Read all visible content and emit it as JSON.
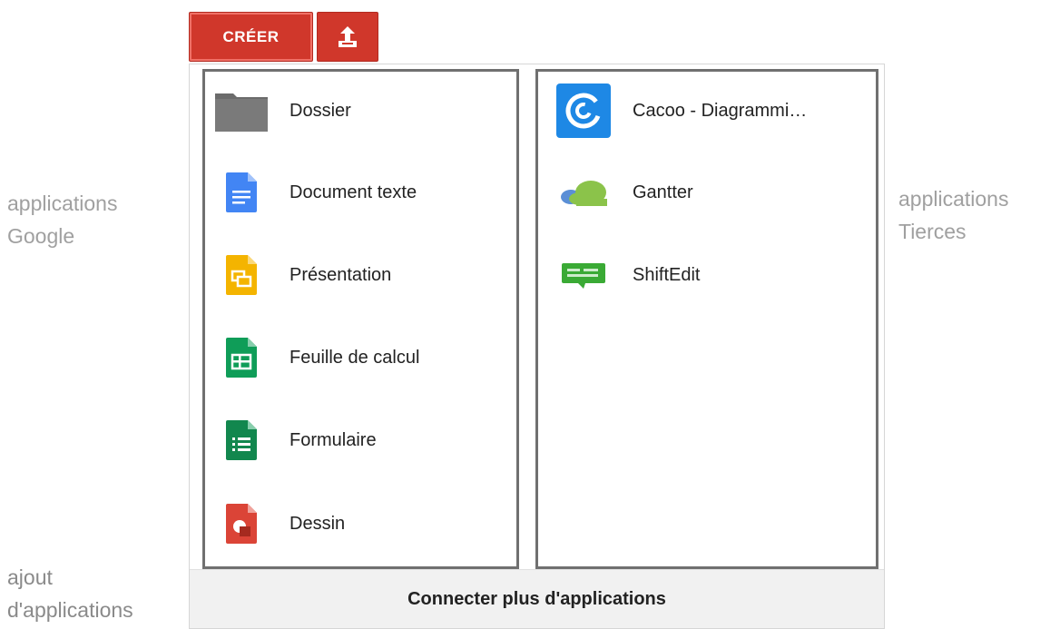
{
  "toolbar": {
    "create_label": "CRÉER",
    "upload_icon": "upload-icon"
  },
  "google_apps": [
    {
      "label": "Dossier",
      "icon": "folder-icon"
    },
    {
      "label": "Document texte",
      "icon": "docs-icon"
    },
    {
      "label": "Présentation",
      "icon": "slides-icon"
    },
    {
      "label": "Feuille de calcul",
      "icon": "sheets-icon"
    },
    {
      "label": "Formulaire",
      "icon": "forms-icon"
    },
    {
      "label": "Dessin",
      "icon": "drawings-icon"
    }
  ],
  "third_party_apps": [
    {
      "label": "Cacoo - Diagrammi…",
      "icon": "cacoo-icon"
    },
    {
      "label": "Gantter",
      "icon": "gantter-icon"
    },
    {
      "label": "ShiftEdit",
      "icon": "shiftedit-icon"
    }
  ],
  "footer": {
    "connect_label": "Connecter plus d'applications"
  },
  "annotations": {
    "google_line1": "applications",
    "google_line2": "Google",
    "third_line1": "applications",
    "third_line2": "Tierces",
    "add_line1": "ajout",
    "add_line2": "d'applications"
  },
  "colors": {
    "create_button": "#d0372b",
    "docs": "#4285f4",
    "slides": "#f4b400",
    "sheets": "#0f9d58",
    "drawings": "#db4437",
    "cacoo": "#1e88e5",
    "gantter": "#8bc34a"
  }
}
